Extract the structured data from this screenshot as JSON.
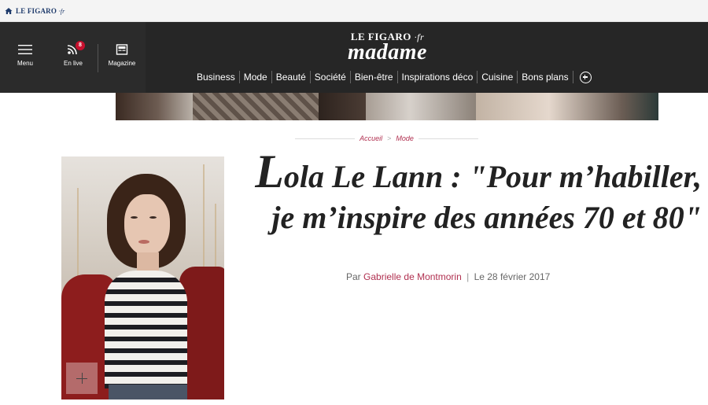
{
  "topbar": {
    "brand": "LE FIGARO",
    "brand_suffix": "·fr"
  },
  "header": {
    "menu_label": "Menu",
    "live_label": "En live",
    "live_count": "8",
    "magazine_label": "Magazine",
    "logo_top": "LE FIGARO",
    "logo_top_suffix": "·fr",
    "logo_main": "madame",
    "nav": [
      "Business",
      "Mode",
      "Beauté",
      "Société",
      "Bien-être",
      "Inspirations déco",
      "Cuisine",
      "Bons plans"
    ]
  },
  "breadcrumb": {
    "home": "Accueil",
    "separator": ">",
    "section": "Mode"
  },
  "article": {
    "title_initial": "L",
    "title_line1_rest": "ola Le Lann : \"Pour m’habiller,",
    "title_line2": "je m’inspire des années 70 et 80\"",
    "byline_prefix": "Par",
    "author": "Gabrielle de Montmorin",
    "byline_sep": "|",
    "date": "Le 28 février 2017"
  },
  "icons": [
    "home-icon",
    "menu-icon",
    "rss-icon",
    "magazine-icon",
    "plus-icon",
    "expand-image-icon"
  ],
  "colors": {
    "header_bg": "#262626",
    "accent": "#b03050",
    "brand_blue": "#1e3a6b"
  }
}
